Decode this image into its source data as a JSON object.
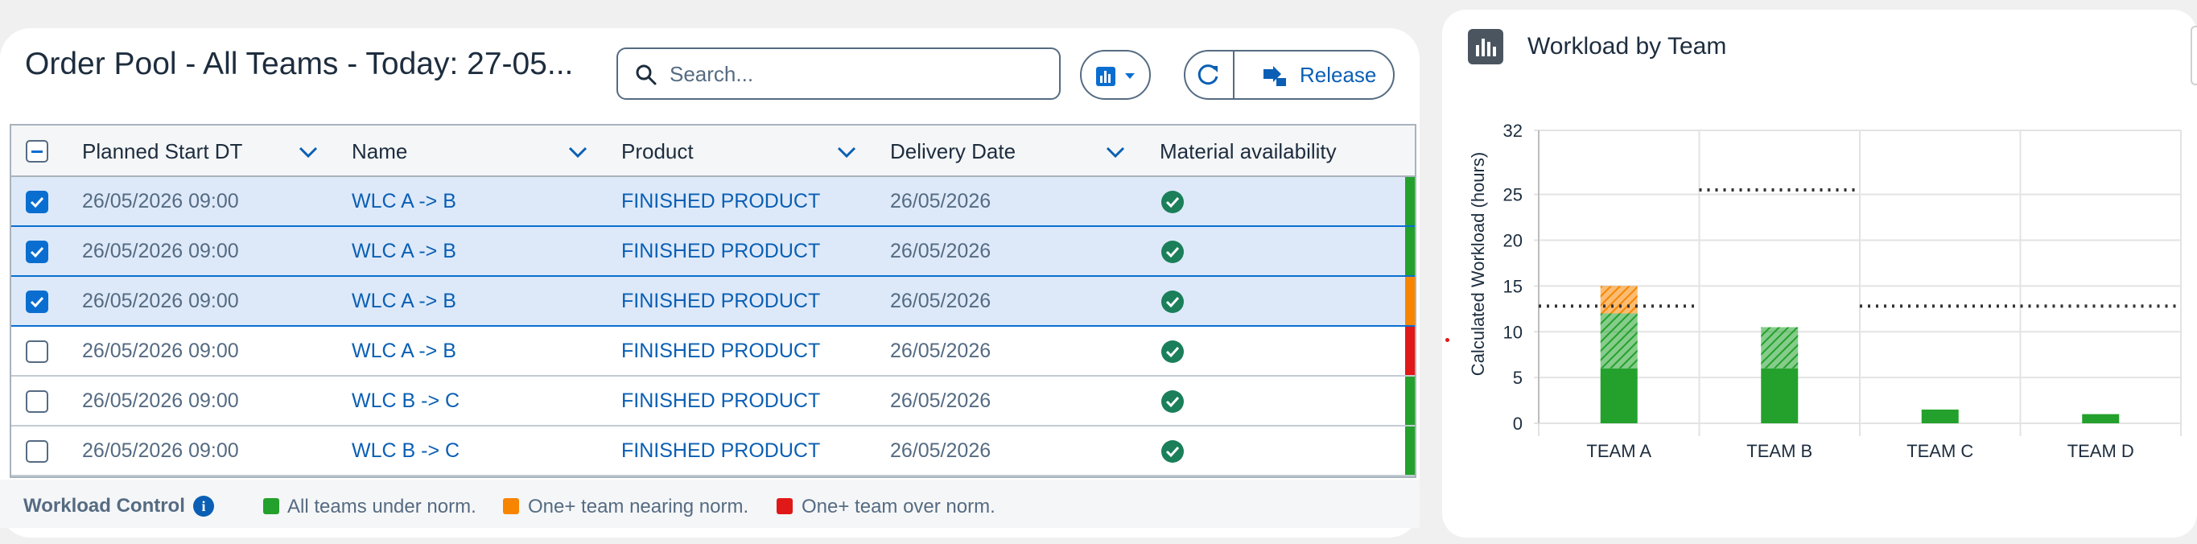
{
  "order_pool": {
    "title": "Order Pool - All Teams - Today: 27-05...",
    "search": {
      "placeholder": "Search..."
    },
    "release_label": "Release",
    "columns": [
      "Planned Start DT",
      "Name",
      "Product",
      "Delivery Date",
      "Material availability"
    ],
    "rows": [
      {
        "selected": true,
        "start": "26/05/2026 09:00",
        "name": "WLC A -> B",
        "product": "FINISHED PRODUCT",
        "delivery": "26/05/2026",
        "status_color": "#23a12c"
      },
      {
        "selected": true,
        "start": "26/05/2026 09:00",
        "name": "WLC A -> B",
        "product": "FINISHED PRODUCT",
        "delivery": "26/05/2026",
        "status_color": "#23a12c"
      },
      {
        "selected": true,
        "start": "26/05/2026 09:00",
        "name": "WLC A -> B",
        "product": "FINISHED PRODUCT",
        "delivery": "26/05/2026",
        "status_color": "#f78500"
      },
      {
        "selected": false,
        "start": "26/05/2026 09:00",
        "name": "WLC A -> B",
        "product": "FINISHED PRODUCT",
        "delivery": "26/05/2026",
        "status_color": "#e01818"
      },
      {
        "selected": false,
        "start": "26/05/2026 09:00",
        "name": "WLC B -> C",
        "product": "FINISHED PRODUCT",
        "delivery": "26/05/2026",
        "status_color": "#23a12c"
      },
      {
        "selected": false,
        "start": "26/05/2026 09:00",
        "name": "WLC B -> C",
        "product": "FINISHED PRODUCT",
        "delivery": "26/05/2026",
        "status_color": "#23a12c"
      }
    ],
    "legend": {
      "title": "Workload Control",
      "items": [
        {
          "label": "All teams under norm.",
          "color": "#23a12c"
        },
        {
          "label": "One+ team nearing norm.",
          "color": "#f78500"
        },
        {
          "label": "One+ team over norm.",
          "color": "#e01818"
        }
      ]
    }
  },
  "workload": {
    "title": "Workload by Team"
  },
  "chart_data": {
    "type": "bar",
    "stacked": true,
    "title": "Workload by Team",
    "xlabel": "",
    "ylabel": "Calculated Workload (hours)",
    "ylim": [
      0,
      32
    ],
    "yticks": [
      0,
      5,
      10,
      15,
      20,
      25,
      32
    ],
    "grid": true,
    "categories": [
      "TEAM A",
      "TEAM B",
      "TEAM C",
      "TEAM D"
    ],
    "series": [
      {
        "color": "#23a12c",
        "pattern": "solid",
        "values": [
          6,
          6,
          1.5,
          1
        ]
      },
      {
        "color": "#23a12c",
        "pattern": "hatched",
        "values": [
          6,
          4.5,
          0,
          0
        ]
      },
      {
        "color": "#f78500",
        "pattern": "hatched",
        "values": [
          3,
          0,
          0,
          0
        ]
      }
    ],
    "norm_lines": [
      12.8,
      25.5,
      12.8,
      12.8
    ]
  }
}
